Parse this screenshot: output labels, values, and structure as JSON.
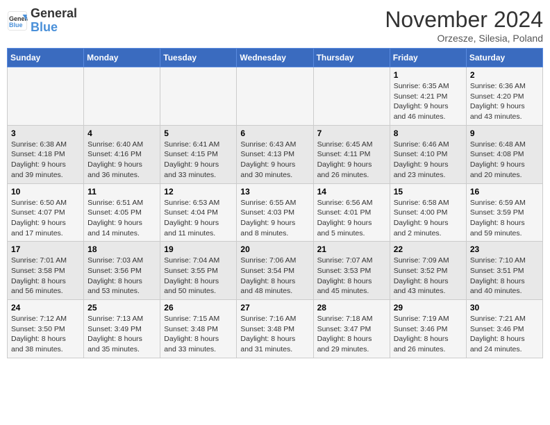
{
  "header": {
    "logo_line1": "General",
    "logo_line2": "Blue",
    "month": "November 2024",
    "location": "Orzesze, Silesia, Poland"
  },
  "days_of_week": [
    "Sunday",
    "Monday",
    "Tuesday",
    "Wednesday",
    "Thursday",
    "Friday",
    "Saturday"
  ],
  "weeks": [
    [
      {
        "day": "",
        "info": ""
      },
      {
        "day": "",
        "info": ""
      },
      {
        "day": "",
        "info": ""
      },
      {
        "day": "",
        "info": ""
      },
      {
        "day": "",
        "info": ""
      },
      {
        "day": "1",
        "info": "Sunrise: 6:35 AM\nSunset: 4:21 PM\nDaylight: 9 hours and 46 minutes."
      },
      {
        "day": "2",
        "info": "Sunrise: 6:36 AM\nSunset: 4:20 PM\nDaylight: 9 hours and 43 minutes."
      }
    ],
    [
      {
        "day": "3",
        "info": "Sunrise: 6:38 AM\nSunset: 4:18 PM\nDaylight: 9 hours and 39 minutes."
      },
      {
        "day": "4",
        "info": "Sunrise: 6:40 AM\nSunset: 4:16 PM\nDaylight: 9 hours and 36 minutes."
      },
      {
        "day": "5",
        "info": "Sunrise: 6:41 AM\nSunset: 4:15 PM\nDaylight: 9 hours and 33 minutes."
      },
      {
        "day": "6",
        "info": "Sunrise: 6:43 AM\nSunset: 4:13 PM\nDaylight: 9 hours and 30 minutes."
      },
      {
        "day": "7",
        "info": "Sunrise: 6:45 AM\nSunset: 4:11 PM\nDaylight: 9 hours and 26 minutes."
      },
      {
        "day": "8",
        "info": "Sunrise: 6:46 AM\nSunset: 4:10 PM\nDaylight: 9 hours and 23 minutes."
      },
      {
        "day": "9",
        "info": "Sunrise: 6:48 AM\nSunset: 4:08 PM\nDaylight: 9 hours and 20 minutes."
      }
    ],
    [
      {
        "day": "10",
        "info": "Sunrise: 6:50 AM\nSunset: 4:07 PM\nDaylight: 9 hours and 17 minutes."
      },
      {
        "day": "11",
        "info": "Sunrise: 6:51 AM\nSunset: 4:05 PM\nDaylight: 9 hours and 14 minutes."
      },
      {
        "day": "12",
        "info": "Sunrise: 6:53 AM\nSunset: 4:04 PM\nDaylight: 9 hours and 11 minutes."
      },
      {
        "day": "13",
        "info": "Sunrise: 6:55 AM\nSunset: 4:03 PM\nDaylight: 9 hours and 8 minutes."
      },
      {
        "day": "14",
        "info": "Sunrise: 6:56 AM\nSunset: 4:01 PM\nDaylight: 9 hours and 5 minutes."
      },
      {
        "day": "15",
        "info": "Sunrise: 6:58 AM\nSunset: 4:00 PM\nDaylight: 9 hours and 2 minutes."
      },
      {
        "day": "16",
        "info": "Sunrise: 6:59 AM\nSunset: 3:59 PM\nDaylight: 8 hours and 59 minutes."
      }
    ],
    [
      {
        "day": "17",
        "info": "Sunrise: 7:01 AM\nSunset: 3:58 PM\nDaylight: 8 hours and 56 minutes."
      },
      {
        "day": "18",
        "info": "Sunrise: 7:03 AM\nSunset: 3:56 PM\nDaylight: 8 hours and 53 minutes."
      },
      {
        "day": "19",
        "info": "Sunrise: 7:04 AM\nSunset: 3:55 PM\nDaylight: 8 hours and 50 minutes."
      },
      {
        "day": "20",
        "info": "Sunrise: 7:06 AM\nSunset: 3:54 PM\nDaylight: 8 hours and 48 minutes."
      },
      {
        "day": "21",
        "info": "Sunrise: 7:07 AM\nSunset: 3:53 PM\nDaylight: 8 hours and 45 minutes."
      },
      {
        "day": "22",
        "info": "Sunrise: 7:09 AM\nSunset: 3:52 PM\nDaylight: 8 hours and 43 minutes."
      },
      {
        "day": "23",
        "info": "Sunrise: 7:10 AM\nSunset: 3:51 PM\nDaylight: 8 hours and 40 minutes."
      }
    ],
    [
      {
        "day": "24",
        "info": "Sunrise: 7:12 AM\nSunset: 3:50 PM\nDaylight: 8 hours and 38 minutes."
      },
      {
        "day": "25",
        "info": "Sunrise: 7:13 AM\nSunset: 3:49 PM\nDaylight: 8 hours and 35 minutes."
      },
      {
        "day": "26",
        "info": "Sunrise: 7:15 AM\nSunset: 3:48 PM\nDaylight: 8 hours and 33 minutes."
      },
      {
        "day": "27",
        "info": "Sunrise: 7:16 AM\nSunset: 3:48 PM\nDaylight: 8 hours and 31 minutes."
      },
      {
        "day": "28",
        "info": "Sunrise: 7:18 AM\nSunset: 3:47 PM\nDaylight: 8 hours and 29 minutes."
      },
      {
        "day": "29",
        "info": "Sunrise: 7:19 AM\nSunset: 3:46 PM\nDaylight: 8 hours and 26 minutes."
      },
      {
        "day": "30",
        "info": "Sunrise: 7:21 AM\nSunset: 3:46 PM\nDaylight: 8 hours and 24 minutes."
      }
    ]
  ]
}
